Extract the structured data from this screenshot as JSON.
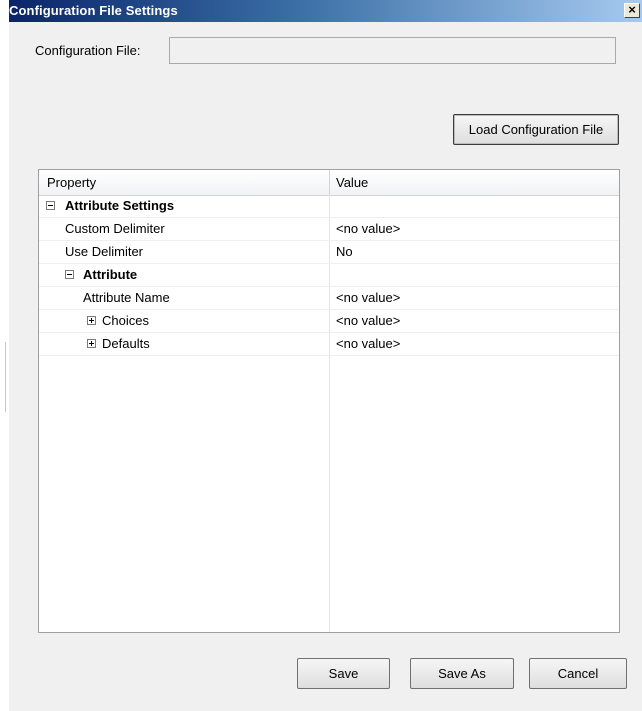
{
  "window": {
    "title": "Configuration File Settings",
    "close_glyph": "×"
  },
  "config_file": {
    "label": "Configuration File:",
    "value": ""
  },
  "buttons": {
    "load": "Load Configuration File",
    "save": "Save",
    "save_as": "Save As",
    "cancel": "Cancel"
  },
  "grid": {
    "headers": {
      "property": "Property",
      "value": "Value"
    },
    "rows": [
      {
        "property": "Attribute Settings",
        "value": ""
      },
      {
        "property": "Custom Delimiter",
        "value": "<no value>"
      },
      {
        "property": "Use Delimiter",
        "value": "No"
      },
      {
        "property": "Attribute",
        "value": ""
      },
      {
        "property": "Attribute Name",
        "value": "<no value>"
      },
      {
        "property": "Choices",
        "value": "<no value>"
      },
      {
        "property": "Defaults",
        "value": "<no value>"
      }
    ]
  }
}
